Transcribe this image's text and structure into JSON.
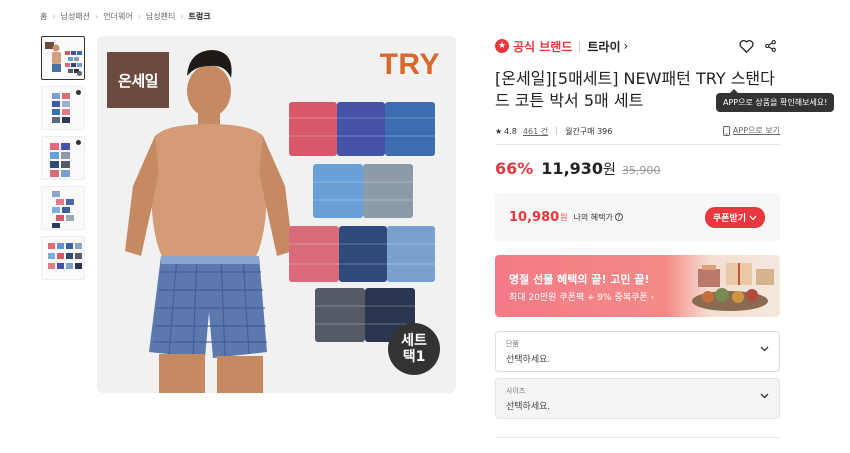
{
  "breadcrumb": {
    "items": [
      "홈",
      "남성패션",
      "언더웨어",
      "남성팬티"
    ],
    "current": "트렁크"
  },
  "product_image": {
    "onsale_badge": "온세일",
    "try_logo": "TRY",
    "set_badge_line1": "세트",
    "set_badge_line2": "택1"
  },
  "brand": {
    "official_label": "공식 브랜드",
    "name": "트라이",
    "chevron": "›"
  },
  "title": "[온세일][5매세트] NEW패턴 TRY 스탠다드 코튼 박서 5매 세트",
  "tooltip": "APP으로 상품을 확인해보세요!",
  "rating": {
    "score": "4.8",
    "review_count": "461 건",
    "monthly_sales": "월간구매 396",
    "app_link": "APP으로 보기"
  },
  "price": {
    "discount": "66%",
    "sale_price": "11,930",
    "won": "원",
    "original": "35,900"
  },
  "benefit": {
    "price": "10,980",
    "won": "원",
    "label": "나의 혜택가",
    "coupon_button": "쿠폰받기"
  },
  "promo": {
    "title": "명절 선물 혜택의 끝! 고민 끝!",
    "subtitle": "최대 20만원 쿠폰팩 + 9% 중복쿠폰 ›"
  },
  "options": [
    {
      "label": "단품",
      "placeholder": "선택하세요."
    },
    {
      "label": "사이즈",
      "placeholder": "선택하세요."
    }
  ],
  "colors": {
    "accent_red": "#e8373e",
    "brand_brown": "#6b4b3e",
    "try_orange": "#d9682c"
  }
}
